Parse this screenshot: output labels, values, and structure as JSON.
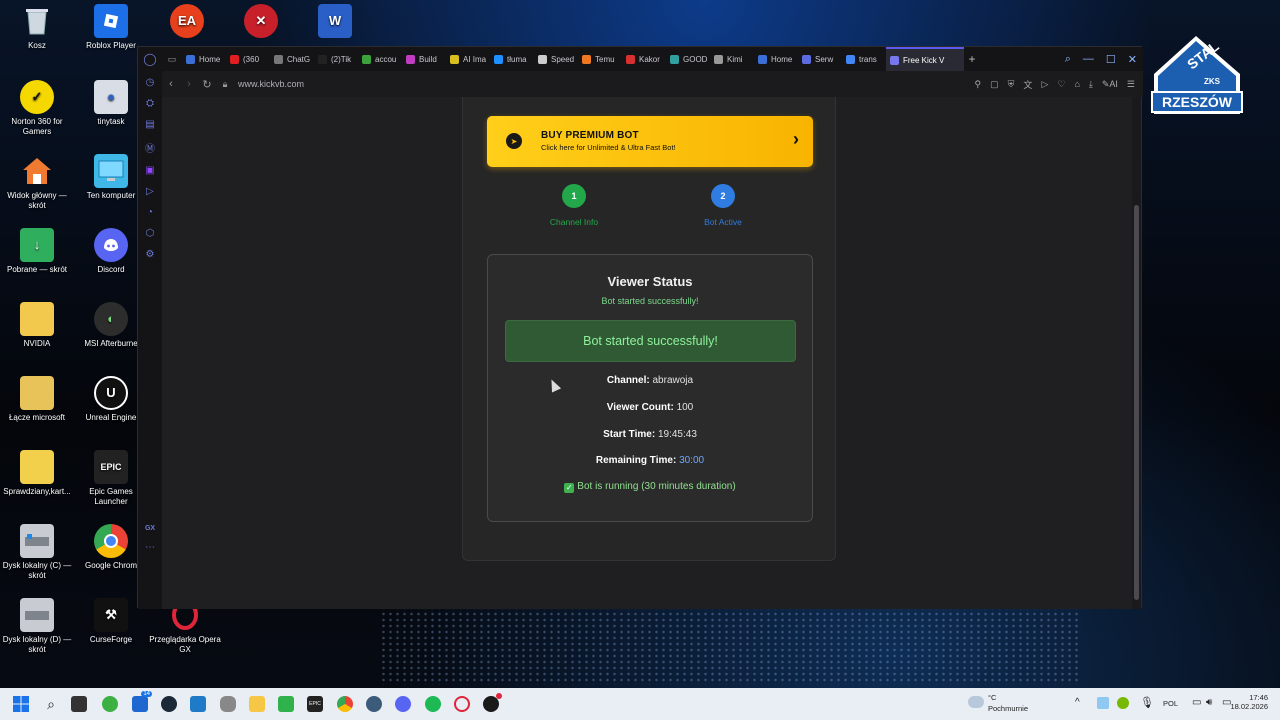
{
  "desktop": {
    "icons": [
      {
        "label": "Kosz"
      },
      {
        "label": "Roblox Player"
      },
      {
        "label": "Norton 360 for Gamers"
      },
      {
        "label": "tinytask"
      },
      {
        "label": "Widok główny — skrót"
      },
      {
        "label": "Ten komputer"
      },
      {
        "label": "Pobrane — skrót"
      },
      {
        "label": "Discord"
      },
      {
        "label": "NVIDIA"
      },
      {
        "label": "MSI Afterburne"
      },
      {
        "label": "Łącze microsoft"
      },
      {
        "label": "Unreal Engine"
      },
      {
        "label": "Sprawdziany,kart..."
      },
      {
        "label": "Epic Games Launcher"
      },
      {
        "label": "Dysk lokalny (C) — skrót"
      },
      {
        "label": "Google Chrom"
      },
      {
        "label": "Dysk lokalny (D) — skrót"
      },
      {
        "label": "CurseForge"
      },
      {
        "label": "Przeglądarka Opera GX"
      }
    ],
    "logo": {
      "top_text": "STAL",
      "badge_text": "ZKS",
      "bottom_text": "RZESZÓW"
    }
  },
  "browser": {
    "tabs": [
      {
        "label": "Home",
        "color": "#3b6fd8"
      },
      {
        "label": "(360",
        "color": "#e02020"
      },
      {
        "label": "ChatG",
        "color": "#777777"
      },
      {
        "label": "(2)Tik",
        "color": "#222222"
      },
      {
        "label": "accou",
        "color": "#3ca33c"
      },
      {
        "label": "Build",
        "color": "#c03cc0"
      },
      {
        "label": "AI Ima",
        "color": "#d8c020"
      },
      {
        "label": "tłuma",
        "color": "#1e90ff"
      },
      {
        "label": "Speed",
        "color": "#cccccc"
      },
      {
        "label": "Temu",
        "color": "#f07820"
      },
      {
        "label": "Kakor",
        "color": "#d83030"
      },
      {
        "label": "GOOD",
        "color": "#30a0a0"
      },
      {
        "label": "Kimi",
        "color": "#999999"
      },
      {
        "label": "Home",
        "color": "#3b6fd8"
      },
      {
        "label": "Serw",
        "color": "#5b6be0"
      },
      {
        "label": "trans",
        "color": "#4285f4"
      },
      {
        "label": "Free Kick V",
        "color": "#7777ee",
        "active": true
      }
    ],
    "url": "www.kickvb.com",
    "ai_label": "AI",
    "side_label": "GX"
  },
  "page": {
    "premium": {
      "title": "BUY PREMIUM BOT",
      "subtitle": "Click here for Unlimited & Ultra Fast Bot!",
      "color": "#ffc400"
    },
    "steps": [
      {
        "number": "1",
        "label": "Channel Info",
        "color": "#22a84a"
      },
      {
        "number": "2",
        "label": "Bot Active",
        "color": "#2f7de0"
      }
    ],
    "status": {
      "title": "Viewer Status",
      "subtitle": "Bot started successfully!",
      "alert": "Bot started successfully!",
      "channel_label": "Channel:",
      "channel_value": "abrawoja",
      "viewer_label": "Viewer Count:",
      "viewer_value": "100",
      "start_label": "Start Time:",
      "start_value": "19:45:43",
      "remaining_label": "Remaining Time:",
      "remaining_value": "30:00",
      "running_text": "Bot is running (30 minutes duration)"
    }
  },
  "taskbar": {
    "weather_temp": "°C",
    "weather_desc": "Pochmurnie",
    "lang": "POL",
    "time": "17:46",
    "date": "18.02.2026",
    "steam_badge": "14"
  }
}
